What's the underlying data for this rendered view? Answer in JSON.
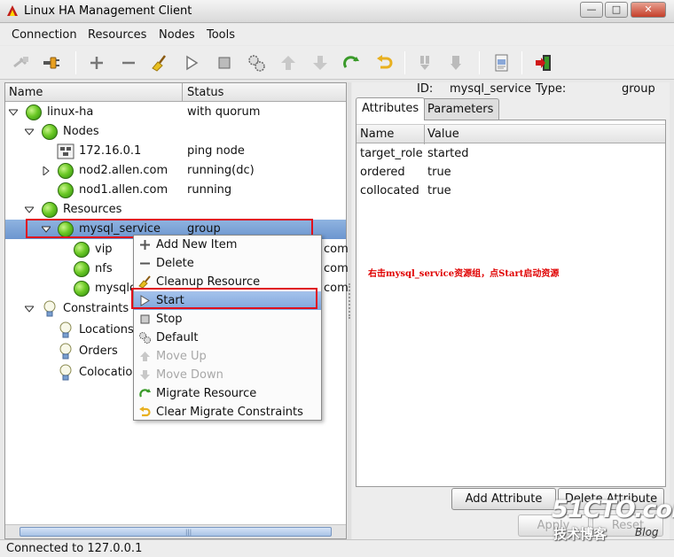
{
  "window": {
    "title": "Linux HA Management Client",
    "minimize": "—",
    "maximize": "□",
    "close": "✕"
  },
  "menubar": [
    "Connection",
    "Resources",
    "Nodes",
    "Tools"
  ],
  "toolbar": {
    "icons": [
      "disconnect-icon",
      "connect-icon",
      "add-icon",
      "remove-icon",
      "cleanup-broom-icon",
      "start-icon",
      "stop-icon",
      "default-gears-icon",
      "move-up-icon",
      "move-down-icon",
      "migrate-icon",
      "clear-migrate-icon",
      "standby-icon",
      "active-icon",
      "view-xml-icon",
      "exit-icon"
    ]
  },
  "tree": {
    "columns": {
      "name": "Name",
      "status": "Status"
    },
    "rows": [
      {
        "label": "linux-ha",
        "status": "with quorum"
      },
      {
        "label": "Nodes",
        "status": ""
      },
      {
        "label": "172.16.0.1",
        "status": "ping node"
      },
      {
        "label": "nod2.allen.com",
        "status": "running(dc)"
      },
      {
        "label": "nod1.allen.com",
        "status": "running"
      },
      {
        "label": "Resources",
        "status": ""
      },
      {
        "label": "mysql_service",
        "status": "group"
      },
      {
        "label": "vip",
        "status": "com"
      },
      {
        "label": "nfs",
        "status": "com"
      },
      {
        "label": "mysqld",
        "status": "com"
      },
      {
        "label": "Constraints",
        "status": ""
      },
      {
        "label": "Locations",
        "status": ""
      },
      {
        "label": "Orders",
        "status": ""
      },
      {
        "label": "Colocations",
        "status": ""
      }
    ]
  },
  "context_menu": [
    {
      "label": "Add New Item",
      "icon": "plus-icon",
      "disabled": false
    },
    {
      "label": "Delete",
      "icon": "minus-icon",
      "disabled": false
    },
    {
      "label": "Cleanup Resource",
      "icon": "broom-icon",
      "disabled": false
    },
    {
      "label": "Start",
      "icon": "play-icon",
      "disabled": false
    },
    {
      "label": "Stop",
      "icon": "stop-icon",
      "disabled": false
    },
    {
      "label": "Default",
      "icon": "gears-icon",
      "disabled": false
    },
    {
      "label": "Move Up",
      "icon": "arrow-up-icon",
      "disabled": true
    },
    {
      "label": "Move Down",
      "icon": "arrow-down-icon",
      "disabled": true
    },
    {
      "label": "Migrate Resource",
      "icon": "migrate-icon",
      "disabled": false
    },
    {
      "label": "Clear Migrate Constraints",
      "icon": "undo-icon",
      "disabled": false
    }
  ],
  "details": {
    "id_label": "ID:",
    "id_value": "mysql_service",
    "type_label": "Type:",
    "type_value": "group",
    "tabs": [
      "Attributes",
      "Parameters"
    ],
    "columns": {
      "name": "Name",
      "value": "Value"
    },
    "rows": [
      {
        "name": "target_role",
        "value": "started"
      },
      {
        "name": "ordered",
        "value": "true"
      },
      {
        "name": "collocated",
        "value": "true"
      }
    ],
    "buttons": {
      "add_attribute": "Add Attribute",
      "delete_attribute": "Delete Attribute",
      "apply": "Apply",
      "reset": "Reset"
    }
  },
  "annotation": "右击mysql_service资源组，点Start启动资源",
  "statusbar": "Connected to 127.0.0.1",
  "watermark": {
    "main": "51CTO.com",
    "sub": "技术博客",
    "blog": "Blog"
  },
  "colors": {
    "highlight": "#e0101c",
    "selection": "#7fa6dc",
    "annotation": "#e00000",
    "bulb": "#6cc926"
  }
}
